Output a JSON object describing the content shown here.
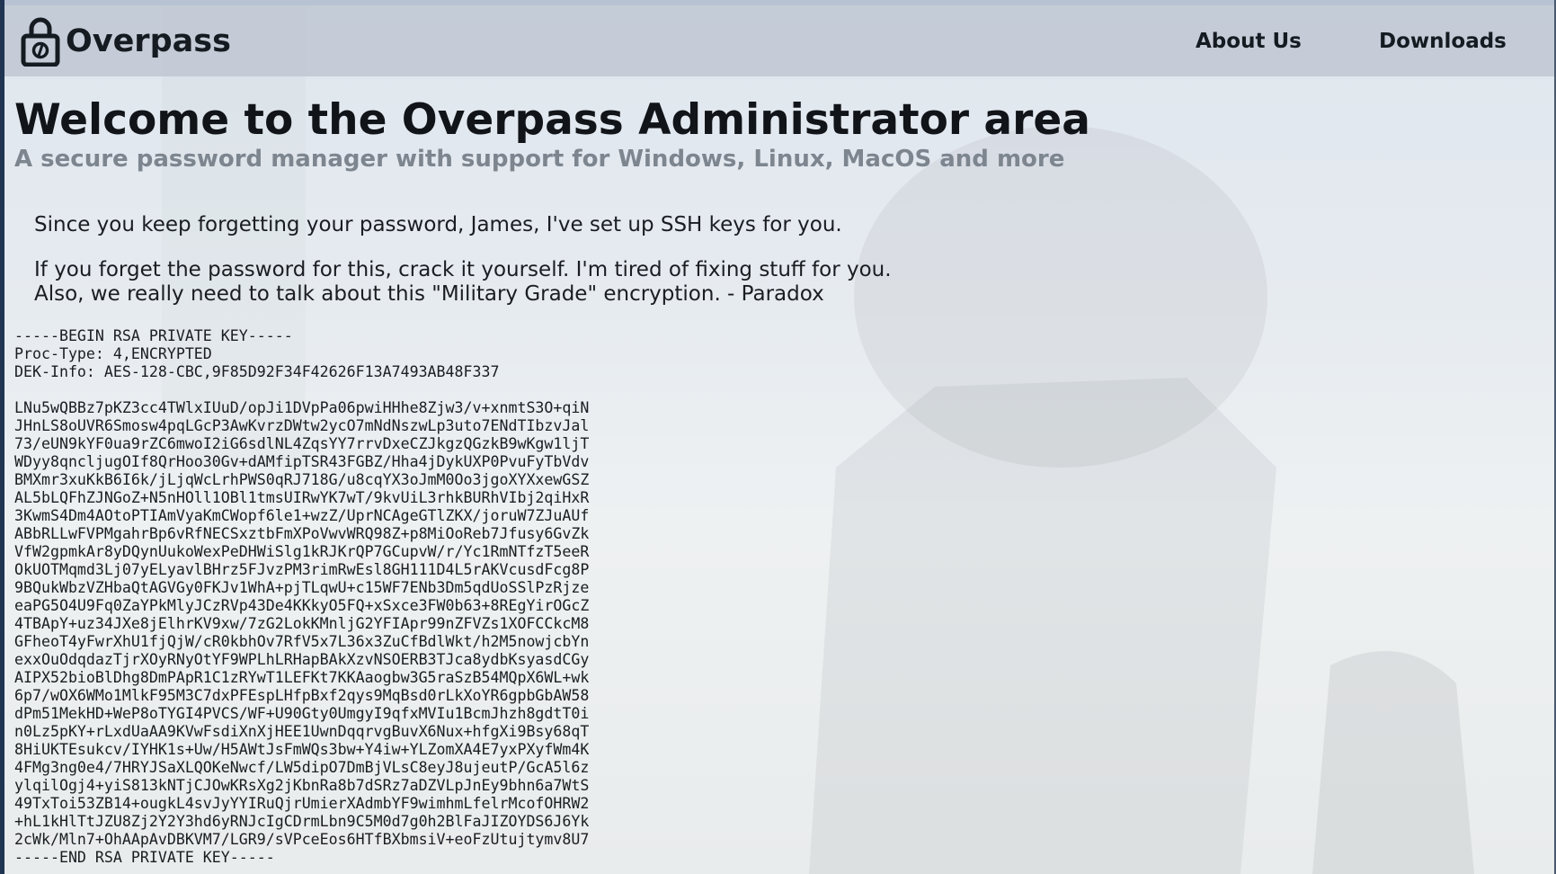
{
  "nav": {
    "brand": "Overpass",
    "links": [
      "About Us",
      "Downloads"
    ]
  },
  "header": {
    "title": "Welcome to the Overpass Administrator area",
    "subtitle": "A secure password manager with support for Windows, Linux, MacOS and more"
  },
  "message": {
    "line1": "Since you keep forgetting your password, James, I've set up SSH keys for you.",
    "line2": "If you forget the password for this, crack it yourself. I'm tired of fixing stuff for you.",
    "line3": "Also, we really need to talk about this \"Military Grade\" encryption. - Paradox"
  },
  "private_key": "-----BEGIN RSA PRIVATE KEY-----\nProc-Type: 4,ENCRYPTED\nDEK-Info: AES-128-CBC,9F85D92F34F42626F13A7493AB48F337\n\nLNu5wQBBz7pKZ3cc4TWlxIUuD/opJi1DVpPa06pwiHHhe8Zjw3/v+xnmtS3O+qiN\nJHnLS8oUVR6Smosw4pqLGcP3AwKvrzDWtw2ycO7mNdNszwLp3uto7ENdTIbzvJal\n73/eUN9kYF0ua9rZC6mwoI2iG6sdlNL4ZqsYY7rrvDxeCZJkgzQGzkB9wKgw1ljT\nWDyy8qncljugOIf8QrHoo30Gv+dAMfipTSR43FGBZ/Hha4jDykUXP0PvuFyTbVdv\nBMXmr3xuKkB6I6k/jLjqWcLrhPWS0qRJ718G/u8cqYX3oJmM0Oo3jgoXYXxewGSZ\nAL5bLQFhZJNGoZ+N5nHOll1OBl1tmsUIRwYK7wT/9kvUiL3rhkBURhVIbj2qiHxR\n3KwmS4Dm4AOtoPTIAmVyaKmCWopf6le1+wzZ/UprNCAgeGTlZKX/joruW7ZJuAUf\nABbRLLwFVPMgahrBp6vRfNECSxztbFmXPoVwvWRQ98Z+p8MiOoReb7Jfusy6GvZk\nVfW2gpmkAr8yDQynUukoWexPeDHWiSlg1kRJKrQP7GCupvW/r/Yc1RmNTfzT5eeR\nOkUOTMqmd3Lj07yELyavlBHrz5FJvzPM3rimRwEsl8GH111D4L5rAKVcusdFcg8P\n9BQukWbzVZHbaQtAGVGy0FKJv1WhA+pjTLqwU+c15WF7ENb3Dm5qdUoSSlPzRjze\neaPG5O4U9Fq0ZaYPkMlyJCzRVp43De4KKkyO5FQ+xSxce3FW0b63+8REgYirOGcZ\n4TBApY+uz34JXe8jElhrKV9xw/7zG2LokKMnljG2YFIApr99nZFVZs1XOFCCkcM8\nGFheoT4yFwrXhU1fjQjW/cR0kbhOv7RfV5x7L36x3ZuCfBdlWkt/h2M5nowjcbYn\nexxOuOdqdazTjrXOyRNyOtYF9WPLhLRHapBAkXzvNSOERB3TJca8ydbKsyasdCGy\nAIPX52bioBlDhg8DmPApR1C1zRYwT1LEFKt7KKAaogbw3G5raSzB54MQpX6WL+wk\n6p7/wOX6WMo1MlkF95M3C7dxPFEspLHfpBxf2qys9MqBsd0rLkXoYR6gpbGbAW58\ndPm51MekHD+WeP8oTYGI4PVCS/WF+U90Gty0UmgyI9qfxMVIu1BcmJhzh8gdtT0i\nn0Lz5pKY+rLxdUaAA9KVwFsdiXnXjHEE1UwnDqqrvgBuvX6Nux+hfgXi9Bsy68qT\n8HiUKTEsukcv/IYHK1s+Uw/H5AWtJsFmWQs3bw+Y4iw+YLZomXA4E7yxPXyfWm4K\n4FMg3ng0e4/7HRYJSaXLQOKeNwcf/LW5dipO7DmBjVLsC8eyJ8ujeutP/GcA5l6z\nylqilOgj4+yiS813kNTjCJOwKRsXg2jKbnRa8b7dSRz7aDZVLpJnEy9bhn6a7WtS\n49TxToi53ZB14+ougkL4svJyYYIRuQjrUmierXAdmbYF9wimhmLfelrMcofOHRW2\n+hL1kHlTtJZU8Zj2Y2Y3hd6yRNJcIgCDrmLbn9C5M0d7g0h2BlFaJIZOYDS6J6Yk\n2cWk/Mln7+OhAApAvDBKVM7/LGR9/sVPceEos6HTfBXbmsiV+eoFzUtujtymv8U7\n-----END RSA PRIVATE KEY-----",
  "colors": {
    "navbar_bg": "#bec6d2",
    "text": "#111418",
    "subtitle": "#7d858f"
  }
}
